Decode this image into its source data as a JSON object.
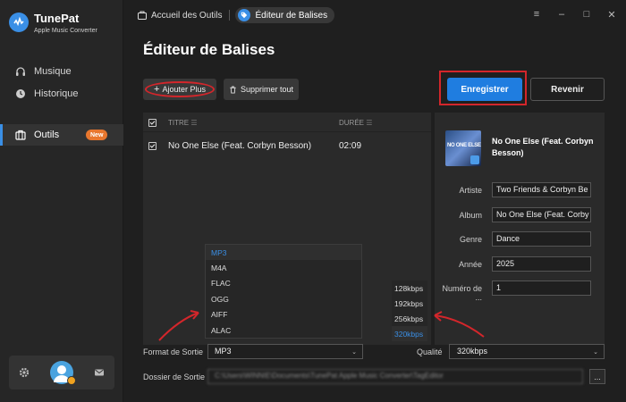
{
  "app": {
    "name": "TunePat",
    "subtitle": "Apple Music Converter"
  },
  "sidebar": {
    "items": [
      {
        "label": "Musique",
        "icon": "headphones-icon"
      },
      {
        "label": "Historique",
        "icon": "clock-icon"
      },
      {
        "label": "Outils",
        "icon": "toolbox-icon",
        "badge": "New",
        "active": true
      }
    ]
  },
  "breadcrumb": {
    "parent": "Accueil des Outils",
    "current": "Éditeur de Balises"
  },
  "page": {
    "title": "Éditeur de Balises"
  },
  "toolbar": {
    "add_label": "Ajouter Plus",
    "delete_label": "Supprimer tout",
    "save_label": "Enregistrer",
    "back_label": "Revenir"
  },
  "table": {
    "headers": {
      "title": "TITRE",
      "duration": "DURÉE"
    },
    "rows": [
      {
        "title": "No One Else (Feat. Corbyn Besson)",
        "duration": "02:09",
        "checked": true
      }
    ]
  },
  "details": {
    "cover_text": "NO ONE ELSE",
    "song_title": "No One Else (Feat. Corbyn Besson)",
    "fields": [
      {
        "label": "Artiste",
        "value": "Two Friends & Corbyn Be"
      },
      {
        "label": "Album",
        "value": "No One Else (Feat. Corby"
      },
      {
        "label": "Genre",
        "value": "Dance"
      },
      {
        "label": "Année",
        "value": "2025"
      },
      {
        "label": "Numéro de ...",
        "value": "1"
      }
    ]
  },
  "format_options": [
    "MP3",
    "M4A",
    "FLAC",
    "OGG",
    "AIFF",
    "ALAC"
  ],
  "format_selected": "MP3",
  "bitrate_options": [
    "128kbps",
    "192kbps",
    "256kbps",
    "320kbps"
  ],
  "bitrate_selected": "320kbps",
  "output": {
    "format_label": "Format de Sortie",
    "format_value": "MP3",
    "quality_label": "Qualité",
    "quality_value": "320kbps",
    "folder_label": "Dossier de Sortie",
    "folder_value": "C:\\Users\\WINNIE\\Documents\\TunePat Apple Music Converter\\TagEditor",
    "browse_label": "..."
  },
  "colors": {
    "accent": "#1f7de0",
    "highlight": "#d3262b",
    "badge": "#e8772e"
  }
}
